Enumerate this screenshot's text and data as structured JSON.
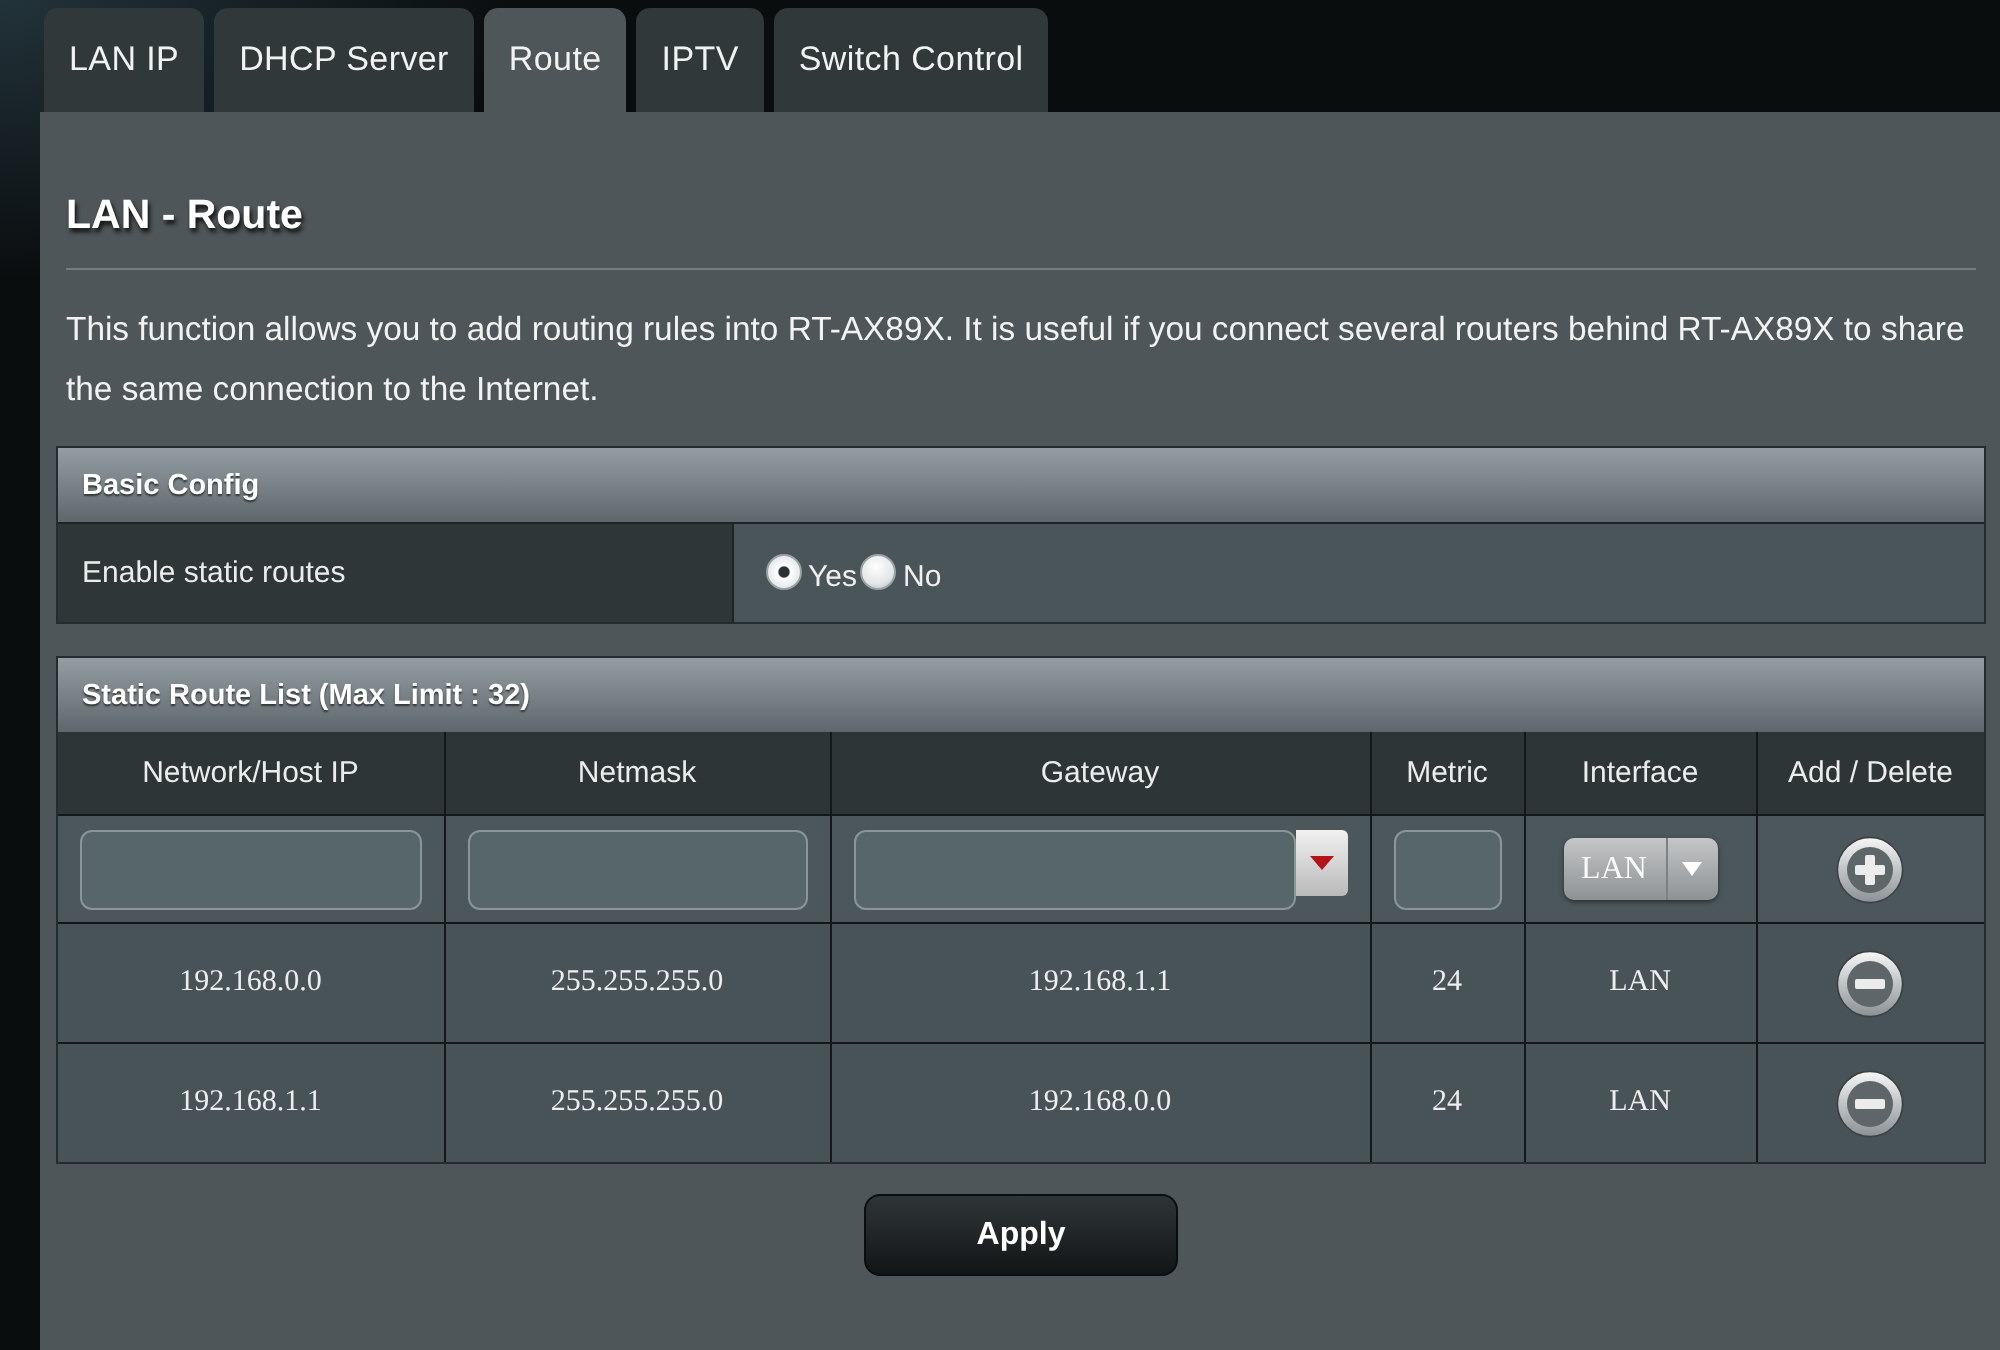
{
  "tabs": [
    {
      "label": "LAN IP",
      "selected": false
    },
    {
      "label": "DHCP Server",
      "selected": false
    },
    {
      "label": "Route",
      "selected": true
    },
    {
      "label": "IPTV",
      "selected": false
    },
    {
      "label": "Switch Control",
      "selected": false
    }
  ],
  "page": {
    "title": "LAN - Route",
    "description": "This function allows you to add routing rules into RT-AX89X. It is useful if you connect several routers behind RT-AX89X to share the same connection to the Internet."
  },
  "basic_config": {
    "title": "Basic Config",
    "settings": [
      {
        "label": "Enable static routes",
        "options": [
          {
            "label": "Yes",
            "selected": true
          },
          {
            "label": "No",
            "selected": false
          }
        ]
      }
    ]
  },
  "static_route_list": {
    "title": "Static Route List (Max Limit : 32)",
    "columns": [
      "Network/Host IP",
      "Netmask",
      "Gateway",
      "Metric",
      "Interface",
      "Add / Delete"
    ],
    "input_row": [
      {
        "kind": "text"
      },
      {
        "kind": "text"
      },
      {
        "kind": "combo"
      },
      {
        "kind": "text"
      },
      {
        "kind": "select",
        "value": "LAN"
      },
      {
        "kind": "add"
      }
    ],
    "rows": [
      {
        "cells": [
          "192.168.0.0",
          "255.255.255.0",
          "192.168.1.1",
          "24",
          "LAN"
        ]
      },
      {
        "cells": [
          "192.168.1.1",
          "255.255.255.0",
          "192.168.0.0",
          "24",
          "LAN"
        ]
      }
    ]
  },
  "apply_button": "Apply"
}
